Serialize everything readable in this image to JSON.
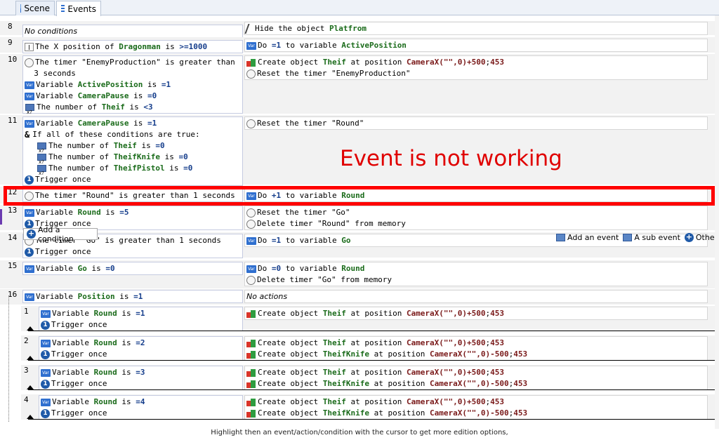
{
  "tabs": [
    {
      "label": "Scene"
    },
    {
      "label": "Events"
    }
  ],
  "events": [
    {
      "num": "8",
      "conditions": [
        [
          {
            "t": "it",
            "v": "No conditions"
          }
        ]
      ],
      "actions": [
        [
          {
            "t": "pen"
          },
          {
            "v": "Hide the object "
          },
          {
            "c": "g",
            "v": "Platfrom"
          }
        ]
      ]
    },
    {
      "num": "9",
      "conditions": [
        [
          {
            "t": "pos"
          },
          {
            "v": "The X position of "
          },
          {
            "c": "g",
            "v": "Dragonman"
          },
          {
            "v": " is "
          },
          {
            "c": "b",
            "v": ">=1000"
          }
        ]
      ],
      "actions": [
        [
          {
            "t": "var"
          },
          {
            "v": "Do "
          },
          {
            "c": "b",
            "v": "=1"
          },
          {
            "v": " to variable "
          },
          {
            "c": "g",
            "v": "ActivePosition"
          }
        ]
      ]
    },
    {
      "num": "10",
      "conditions": [
        [
          {
            "t": "tmr"
          },
          {
            "v": "The timer \"EnemyProduction\" is greater than"
          }
        ],
        [
          {
            "v": "  3 seconds"
          }
        ],
        [
          {
            "t": "var"
          },
          {
            "v": "Variable "
          },
          {
            "c": "g",
            "v": "ActivePosition"
          },
          {
            "v": " is "
          },
          {
            "c": "b",
            "v": "=1"
          }
        ],
        [
          {
            "t": "var"
          },
          {
            "v": "Variable "
          },
          {
            "c": "g",
            "v": "CameraPause"
          },
          {
            "v": " is "
          },
          {
            "c": "b",
            "v": "=0"
          }
        ],
        [
          {
            "t": "cnt"
          },
          {
            "v": "The number of "
          },
          {
            "c": "g",
            "v": "Theif"
          },
          {
            "v": " is "
          },
          {
            "c": "b",
            "v": "<3"
          }
        ]
      ],
      "actions": [
        [
          {
            "t": "crt"
          },
          {
            "v": "Create object "
          },
          {
            "c": "g",
            "v": "Theif"
          },
          {
            "v": " at position "
          },
          {
            "c": "r",
            "v": "CameraX(\"\",0)+500"
          },
          {
            "v": ";"
          },
          {
            "c": "r",
            "v": "453"
          }
        ],
        [
          {
            "t": "tmr"
          },
          {
            "v": "Reset the timer \"EnemyProduction\""
          }
        ]
      ]
    },
    {
      "num": "11",
      "conditions": [
        [
          {
            "t": "var"
          },
          {
            "v": "Variable "
          },
          {
            "c": "g",
            "v": "CameraPause"
          },
          {
            "v": " is "
          },
          {
            "c": "b",
            "v": "=1"
          }
        ],
        [
          {
            "t": "amp"
          },
          {
            "v": "If all of these conditions are true:"
          }
        ],
        [
          {
            "t": "sp"
          },
          {
            "t": "cnt"
          },
          {
            "v": "The number of "
          },
          {
            "c": "g",
            "v": "Theif"
          },
          {
            "v": " is "
          },
          {
            "c": "b",
            "v": "=0"
          }
        ],
        [
          {
            "t": "sp"
          },
          {
            "t": "cnt"
          },
          {
            "v": "The number of "
          },
          {
            "c": "g",
            "v": "TheifKnife"
          },
          {
            "v": " is "
          },
          {
            "c": "b",
            "v": "=0"
          }
        ],
        [
          {
            "t": "sp"
          },
          {
            "t": "cnt"
          },
          {
            "v": "The number of "
          },
          {
            "c": "g",
            "v": "TheifPistol"
          },
          {
            "v": " is "
          },
          {
            "c": "b",
            "v": "=0"
          }
        ],
        [
          {
            "t": "one"
          },
          {
            "v": "Trigger once"
          }
        ]
      ],
      "actions": [
        [
          {
            "t": "tmr"
          },
          {
            "v": "Reset the timer \"Round\""
          }
        ]
      ]
    },
    {
      "num": "12",
      "conditions": [
        [
          {
            "t": "tmr"
          },
          {
            "v": "The timer \"Round\" is greater than 1 seconds"
          }
        ]
      ],
      "actions": [
        [
          {
            "t": "var"
          },
          {
            "v": "Do "
          },
          {
            "c": "b",
            "v": "+1"
          },
          {
            "v": " to variable "
          },
          {
            "c": "g",
            "v": "Round"
          }
        ]
      ]
    },
    {
      "num": "13",
      "conditions": [
        [
          {
            "t": "var"
          },
          {
            "v": "Variable "
          },
          {
            "c": "g",
            "v": "Round"
          },
          {
            "v": " is "
          },
          {
            "c": "b",
            "v": "=5"
          }
        ],
        [
          {
            "t": "one"
          },
          {
            "v": "Trigger once"
          }
        ]
      ],
      "actions": [
        [
          {
            "t": "tmr"
          },
          {
            "v": "Reset the timer \"Go\""
          }
        ],
        [
          {
            "t": "tmr"
          },
          {
            "v": "Delete timer \"Round\" from memory"
          }
        ]
      ]
    },
    {
      "num": "14",
      "conditions": [
        [
          {
            "t": "tmr"
          },
          {
            "v": "The timer \"Go\" is greater than 1 seconds"
          }
        ],
        [
          {
            "t": "one"
          },
          {
            "v": "Trigger once"
          }
        ]
      ],
      "actions": [
        [
          {
            "t": "var"
          },
          {
            "v": "Do "
          },
          {
            "c": "b",
            "v": "=1"
          },
          {
            "v": " to variable "
          },
          {
            "c": "g",
            "v": "Go"
          }
        ]
      ]
    },
    {
      "num": "15",
      "conditions": [
        [
          {
            "t": "var"
          },
          {
            "v": "Variable "
          },
          {
            "c": "g",
            "v": "Go"
          },
          {
            "v": " is "
          },
          {
            "c": "b",
            "v": "=0"
          }
        ]
      ],
      "actions": [
        [
          {
            "t": "var"
          },
          {
            "v": "Do "
          },
          {
            "c": "b",
            "v": "=0"
          },
          {
            "v": " to variable "
          },
          {
            "c": "g",
            "v": "Round"
          }
        ],
        [
          {
            "t": "tmr"
          },
          {
            "v": "Delete timer \"Go\" from memory"
          }
        ]
      ]
    },
    {
      "num": "16",
      "conditions": [
        [
          {
            "t": "var"
          },
          {
            "v": "Variable "
          },
          {
            "c": "g",
            "v": "Position"
          },
          {
            "v": " is "
          },
          {
            "c": "b",
            "v": "=1"
          }
        ]
      ],
      "actions": [
        [
          {
            "t": "it",
            "v": "No actions"
          }
        ]
      ]
    }
  ],
  "subevents": [
    {
      "num": "1",
      "conditions": [
        [
          {
            "t": "var"
          },
          {
            "v": "Variable "
          },
          {
            "c": "g",
            "v": "Round"
          },
          {
            "v": " is "
          },
          {
            "c": "b",
            "v": "=1"
          }
        ],
        [
          {
            "t": "one"
          },
          {
            "v": "Trigger once"
          }
        ]
      ],
      "actions": [
        [
          {
            "t": "crt"
          },
          {
            "v": "Create object "
          },
          {
            "c": "g",
            "v": "Theif"
          },
          {
            "v": " at position "
          },
          {
            "c": "r",
            "v": "CameraX(\"\",0)+500"
          },
          {
            "v": ";"
          },
          {
            "c": "r",
            "v": "453"
          }
        ]
      ]
    },
    {
      "num": "2",
      "conditions": [
        [
          {
            "t": "var"
          },
          {
            "v": "Variable "
          },
          {
            "c": "g",
            "v": "Round"
          },
          {
            "v": " is "
          },
          {
            "c": "b",
            "v": "=2"
          }
        ],
        [
          {
            "t": "one"
          },
          {
            "v": "Trigger once"
          }
        ]
      ],
      "actions": [
        [
          {
            "t": "crt"
          },
          {
            "v": "Create object "
          },
          {
            "c": "g",
            "v": "Theif"
          },
          {
            "v": " at position "
          },
          {
            "c": "r",
            "v": "CameraX(\"\",0)+500"
          },
          {
            "v": ";"
          },
          {
            "c": "r",
            "v": "453"
          }
        ],
        [
          {
            "t": "crt"
          },
          {
            "v": "Create object "
          },
          {
            "c": "g",
            "v": "TheifKnife"
          },
          {
            "v": " at position "
          },
          {
            "c": "r",
            "v": "CameraX(\"\",0)-500"
          },
          {
            "v": ";"
          },
          {
            "c": "r",
            "v": "453"
          }
        ]
      ]
    },
    {
      "num": "3",
      "conditions": [
        [
          {
            "t": "var"
          },
          {
            "v": "Variable "
          },
          {
            "c": "g",
            "v": "Round"
          },
          {
            "v": " is "
          },
          {
            "c": "b",
            "v": "=3"
          }
        ],
        [
          {
            "t": "one"
          },
          {
            "v": "Trigger once"
          }
        ]
      ],
      "actions": [
        [
          {
            "t": "crt"
          },
          {
            "v": "Create object "
          },
          {
            "c": "g",
            "v": "Theif"
          },
          {
            "v": " at position "
          },
          {
            "c": "r",
            "v": "CameraX(\"\",0)+500"
          },
          {
            "v": ";"
          },
          {
            "c": "r",
            "v": "453"
          }
        ],
        [
          {
            "t": "crt"
          },
          {
            "v": "Create object "
          },
          {
            "c": "g",
            "v": "TheifKnife"
          },
          {
            "v": " at position "
          },
          {
            "c": "r",
            "v": "CameraX(\"\",0)-500"
          },
          {
            "v": ";"
          },
          {
            "c": "r",
            "v": "453"
          }
        ]
      ]
    },
    {
      "num": "4",
      "conditions": [
        [
          {
            "t": "var"
          },
          {
            "v": "Variable "
          },
          {
            "c": "g",
            "v": "Round"
          },
          {
            "v": " is "
          },
          {
            "c": "b",
            "v": "=4"
          }
        ],
        [
          {
            "t": "one"
          },
          {
            "v": "Trigger once"
          }
        ]
      ],
      "actions": [
        [
          {
            "t": "crt"
          },
          {
            "v": "Create object "
          },
          {
            "c": "g",
            "v": "Theif"
          },
          {
            "v": " at position "
          },
          {
            "c": "r",
            "v": "CameraX(\"\",0)+500"
          },
          {
            "v": ";"
          },
          {
            "c": "r",
            "v": "453"
          }
        ],
        [
          {
            "t": "crt"
          },
          {
            "v": "Create object "
          },
          {
            "c": "g",
            "v": "TheifKnife"
          },
          {
            "v": " at position "
          },
          {
            "c": "r",
            "v": "CameraX(\"\",0)-500"
          },
          {
            "v": ";"
          },
          {
            "c": "r",
            "v": "453"
          }
        ]
      ]
    }
  ],
  "annotation": "Event is not working",
  "context": {
    "add_condition": "Add a condition",
    "add_event": "Add an event",
    "sub_event": "A sub event",
    "other": "Other"
  },
  "hint": "Highlight then an event/action/condition with the cursor to get more edition options,"
}
